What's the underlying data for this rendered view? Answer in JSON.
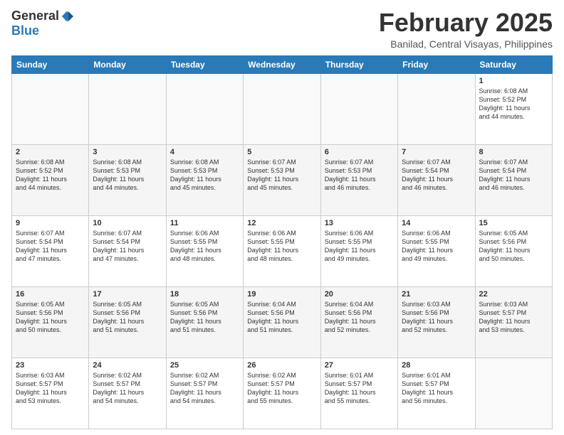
{
  "logo": {
    "general": "General",
    "blue": "Blue"
  },
  "header": {
    "month": "February 2025",
    "location": "Banilad, Central Visayas, Philippines"
  },
  "days_of_week": [
    "Sunday",
    "Monday",
    "Tuesday",
    "Wednesday",
    "Thursday",
    "Friday",
    "Saturday"
  ],
  "weeks": [
    [
      {
        "day": "",
        "info": ""
      },
      {
        "day": "",
        "info": ""
      },
      {
        "day": "",
        "info": ""
      },
      {
        "day": "",
        "info": ""
      },
      {
        "day": "",
        "info": ""
      },
      {
        "day": "",
        "info": ""
      },
      {
        "day": "1",
        "info": "Sunrise: 6:08 AM\nSunset: 5:52 PM\nDaylight: 11 hours\nand 44 minutes."
      }
    ],
    [
      {
        "day": "2",
        "info": "Sunrise: 6:08 AM\nSunset: 5:52 PM\nDaylight: 11 hours\nand 44 minutes."
      },
      {
        "day": "3",
        "info": "Sunrise: 6:08 AM\nSunset: 5:53 PM\nDaylight: 11 hours\nand 44 minutes."
      },
      {
        "day": "4",
        "info": "Sunrise: 6:08 AM\nSunset: 5:53 PM\nDaylight: 11 hours\nand 45 minutes."
      },
      {
        "day": "5",
        "info": "Sunrise: 6:07 AM\nSunset: 5:53 PM\nDaylight: 11 hours\nand 45 minutes."
      },
      {
        "day": "6",
        "info": "Sunrise: 6:07 AM\nSunset: 5:53 PM\nDaylight: 11 hours\nand 46 minutes."
      },
      {
        "day": "7",
        "info": "Sunrise: 6:07 AM\nSunset: 5:54 PM\nDaylight: 11 hours\nand 46 minutes."
      },
      {
        "day": "8",
        "info": "Sunrise: 6:07 AM\nSunset: 5:54 PM\nDaylight: 11 hours\nand 46 minutes."
      }
    ],
    [
      {
        "day": "9",
        "info": "Sunrise: 6:07 AM\nSunset: 5:54 PM\nDaylight: 11 hours\nand 47 minutes."
      },
      {
        "day": "10",
        "info": "Sunrise: 6:07 AM\nSunset: 5:54 PM\nDaylight: 11 hours\nand 47 minutes."
      },
      {
        "day": "11",
        "info": "Sunrise: 6:06 AM\nSunset: 5:55 PM\nDaylight: 11 hours\nand 48 minutes."
      },
      {
        "day": "12",
        "info": "Sunrise: 6:06 AM\nSunset: 5:55 PM\nDaylight: 11 hours\nand 48 minutes."
      },
      {
        "day": "13",
        "info": "Sunrise: 6:06 AM\nSunset: 5:55 PM\nDaylight: 11 hours\nand 49 minutes."
      },
      {
        "day": "14",
        "info": "Sunrise: 6:06 AM\nSunset: 5:55 PM\nDaylight: 11 hours\nand 49 minutes."
      },
      {
        "day": "15",
        "info": "Sunrise: 6:05 AM\nSunset: 5:56 PM\nDaylight: 11 hours\nand 50 minutes."
      }
    ],
    [
      {
        "day": "16",
        "info": "Sunrise: 6:05 AM\nSunset: 5:56 PM\nDaylight: 11 hours\nand 50 minutes."
      },
      {
        "day": "17",
        "info": "Sunrise: 6:05 AM\nSunset: 5:56 PM\nDaylight: 11 hours\nand 51 minutes."
      },
      {
        "day": "18",
        "info": "Sunrise: 6:05 AM\nSunset: 5:56 PM\nDaylight: 11 hours\nand 51 minutes."
      },
      {
        "day": "19",
        "info": "Sunrise: 6:04 AM\nSunset: 5:56 PM\nDaylight: 11 hours\nand 51 minutes."
      },
      {
        "day": "20",
        "info": "Sunrise: 6:04 AM\nSunset: 5:56 PM\nDaylight: 11 hours\nand 52 minutes."
      },
      {
        "day": "21",
        "info": "Sunrise: 6:03 AM\nSunset: 5:56 PM\nDaylight: 11 hours\nand 52 minutes."
      },
      {
        "day": "22",
        "info": "Sunrise: 6:03 AM\nSunset: 5:57 PM\nDaylight: 11 hours\nand 53 minutes."
      }
    ],
    [
      {
        "day": "23",
        "info": "Sunrise: 6:03 AM\nSunset: 5:57 PM\nDaylight: 11 hours\nand 53 minutes."
      },
      {
        "day": "24",
        "info": "Sunrise: 6:02 AM\nSunset: 5:57 PM\nDaylight: 11 hours\nand 54 minutes."
      },
      {
        "day": "25",
        "info": "Sunrise: 6:02 AM\nSunset: 5:57 PM\nDaylight: 11 hours\nand 54 minutes."
      },
      {
        "day": "26",
        "info": "Sunrise: 6:02 AM\nSunset: 5:57 PM\nDaylight: 11 hours\nand 55 minutes."
      },
      {
        "day": "27",
        "info": "Sunrise: 6:01 AM\nSunset: 5:57 PM\nDaylight: 11 hours\nand 55 minutes."
      },
      {
        "day": "28",
        "info": "Sunrise: 6:01 AM\nSunset: 5:57 PM\nDaylight: 11 hours\nand 56 minutes."
      },
      {
        "day": "",
        "info": ""
      }
    ]
  ]
}
